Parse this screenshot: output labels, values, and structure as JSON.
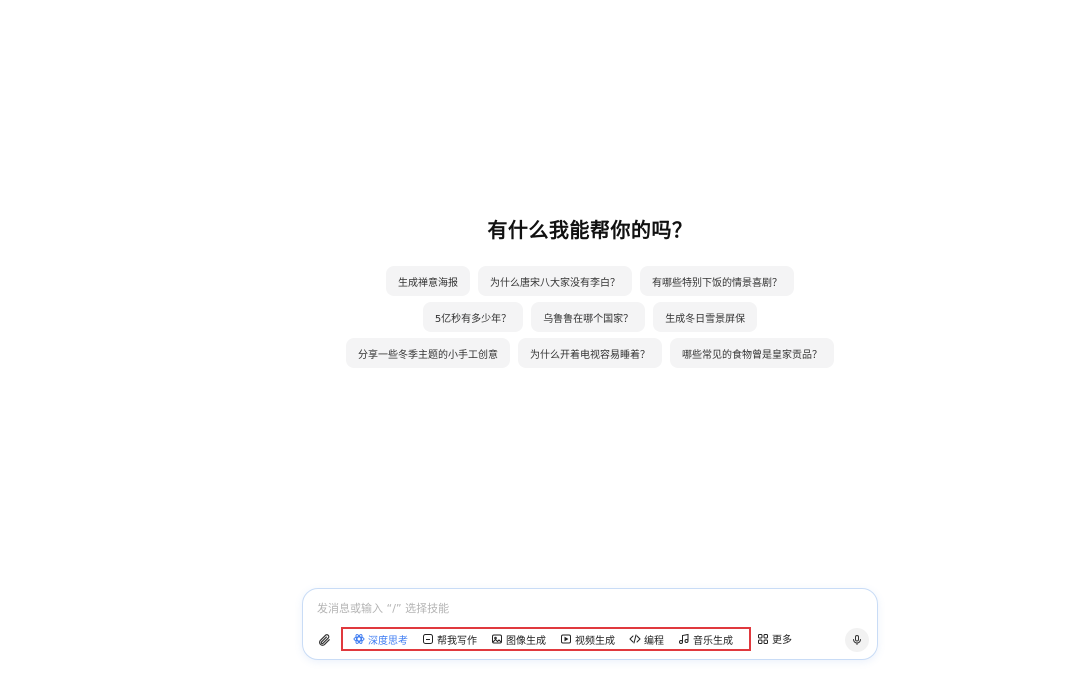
{
  "heading": "有什么我能帮你的吗？",
  "suggestions": [
    [
      "生成禅意海报",
      "为什么唐宋八大家没有李白？",
      "有哪些特别下饭的情景喜剧？"
    ],
    [
      "5亿秒有多少年？",
      "乌鲁鲁在哪个国家？",
      "生成冬日雪景屏保"
    ],
    [
      "分享一些冬季主题的小手工创意",
      "为什么开着电视容易睡着？",
      "哪些常见的食物曾是皇家贡品？"
    ]
  ],
  "input": {
    "placeholder": "发消息或输入 “/” 选择技能",
    "value": ""
  },
  "skills": [
    {
      "label": "深度思考",
      "icon": "atom-icon",
      "active": true
    },
    {
      "label": "帮我写作",
      "icon": "pen-box-icon",
      "active": false
    },
    {
      "label": "图像生成",
      "icon": "image-icon",
      "active": false
    },
    {
      "label": "视频生成",
      "icon": "play-box-icon",
      "active": false
    },
    {
      "label": "编程",
      "icon": "code-icon",
      "active": false
    },
    {
      "label": "音乐生成",
      "icon": "music-note-icon",
      "active": false
    }
  ],
  "more_label": "更多",
  "colors": {
    "accent": "#3d7bf2",
    "highlight_border": "#e0393e",
    "chip_bg": "#f4f4f5",
    "input_border": "#c9dcf6"
  }
}
